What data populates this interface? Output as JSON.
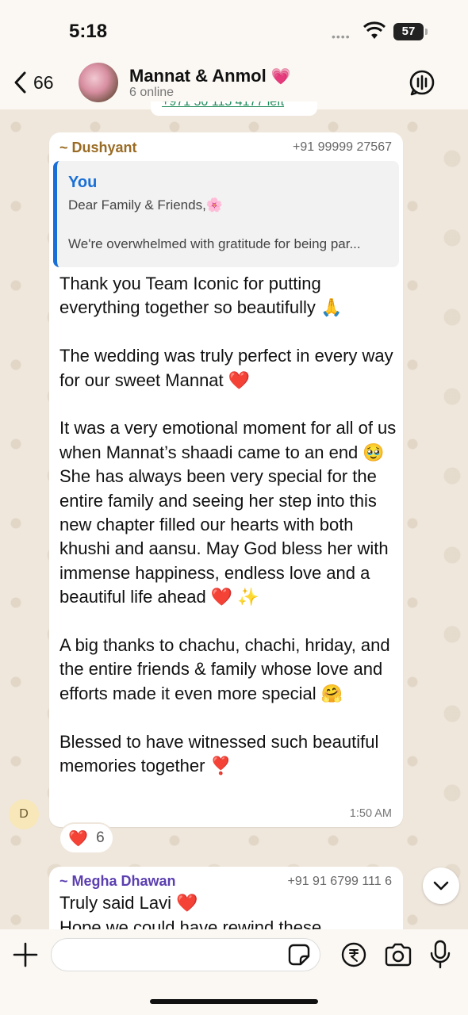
{
  "status_bar": {
    "time": "5:18",
    "battery": "57",
    "signal_dots": "••••"
  },
  "header": {
    "back_count": "66",
    "title": "Mannat & Anmol",
    "title_emoji": "💗",
    "subtitle": "6 online"
  },
  "cut_message": {
    "link_text": "+971 50 115 4177 left"
  },
  "messages": [
    {
      "sender": "~ Dushyant",
      "phone": "+91 99999 27567",
      "quote": {
        "author": "You",
        "line1": "Dear Family & Friends,🌸",
        "line2": "We're overwhelmed with gratitude for being par..."
      },
      "paragraphs": [
        "Thank you Team Iconic for putting everything together so beautifully 🙏",
        "The wedding was truly perfect in every way for our sweet Mannat ❤️",
        "It was a very emotional moment for all of us when Mannat’s shaadi came to an end 🥹 She has always been very special for the entire family and seeing her step into this new chapter filled our hearts with both khushi and aansu. May God bless her with immense happiness, endless love and a beautiful life ahead ❤️ ✨",
        "A big thanks to chachu, chachi, hriday, and the entire friends & family whose love and efforts made it even more special 🤗",
        "Blessed to have witnessed such beautiful memories together ❣️"
      ],
      "time": "1:50 AM",
      "sender_initial": "D",
      "reaction": {
        "emoji": "❤️",
        "count": "6"
      }
    },
    {
      "sender": "~ Megha Dhawan",
      "phone": "+91 91 6799 111 6",
      "line1": "Truly said Lavi ❤️",
      "line2": "Hope we could have rewind these"
    }
  ],
  "input": {
    "placeholder": ""
  },
  "icons": {
    "back": "chevron-left-icon",
    "call": "voice-chat-icon",
    "scroll": "chevron-down-icon",
    "plus": "plus-icon",
    "sticker": "sticker-icon",
    "payment": "rupee-icon",
    "camera": "camera-icon",
    "mic": "microphone-icon"
  },
  "colors": {
    "sender1": "#9a6b24",
    "sender2": "#5b3fb0",
    "quote_accent": "#1a6fd6",
    "chat_background": "#efe7dc"
  }
}
